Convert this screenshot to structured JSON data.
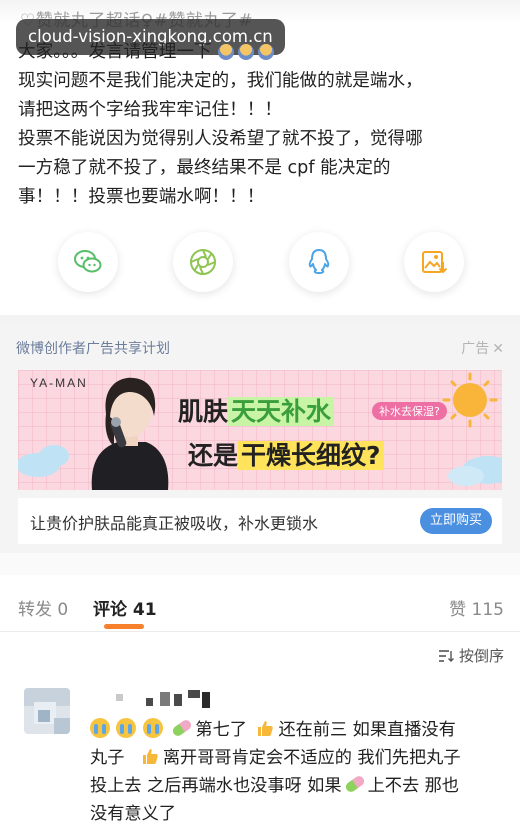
{
  "topic_line": "♡赞就丸了超话♀#赞就丸了#",
  "watermark": "cloud-vision-xingkong.com.cn",
  "post": {
    "lines": [
      "大家。。。发言请管理一下",
      "现实问题不是我们能决定的，我们能做的就是端水，",
      "请把这两个字给我牢牢记住！！！",
      "投票不能说因为觉得别人没希望了就不投了，觉得哪",
      "一方稳了就不投了，最终结果不是 cpf 能决定的",
      "事！！！投票也要端水啊！！！"
    ]
  },
  "share_buttons": [
    {
      "name": "wechat",
      "icon": "wechat-icon",
      "color": "#57be6a"
    },
    {
      "name": "moments",
      "icon": "moments-icon",
      "color": "#8fc452"
    },
    {
      "name": "qq",
      "icon": "qq-icon",
      "color": "#4aa4e8"
    },
    {
      "name": "save-image",
      "icon": "save-image-icon",
      "color": "#f5a623"
    }
  ],
  "ad": {
    "header": "微博创作者广告共享计划",
    "tag": "广告",
    "close_icon": "close-icon",
    "banner": {
      "brand": "YA-MAN",
      "line1_prefix": "肌肤",
      "line1_highlight": "天天补水",
      "badge": "补水去保湿?",
      "line2_prefix": "还是",
      "line2_highlight": "干燥长细纹?"
    },
    "description": "让贵价护肤品能真正被吸收，补水更锁水",
    "button": "立即购买",
    "accent": "#4a8fe0"
  },
  "tabs": {
    "repost": "转发 0",
    "comment": "评论 41",
    "like": "赞 115",
    "indicator_color": "#f7802d"
  },
  "sort_label": "按倒序",
  "comment": {
    "seg1": "第七了",
    "seg2": "还在前三  如果直播没有",
    "line2_a": "丸子",
    "line2_b": "离开哥哥肯定会不适应的 我们先把丸子",
    "line3": "投上去 之后再端水也没事呀 如果",
    "line3_b": "上不去 那也",
    "line4": "没有意义了"
  }
}
